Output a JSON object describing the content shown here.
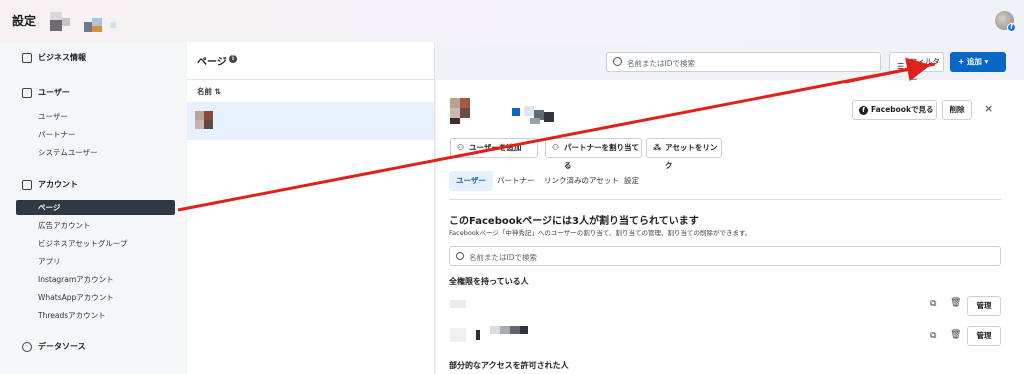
{
  "topbar": {
    "title": "設定"
  },
  "sidebar": {
    "business_info": "ビジネス情報",
    "users_section": "ユーザー",
    "users_items": [
      "ユーザー",
      "パートナー",
      "システムユーザー"
    ],
    "accounts_section": "アカウント",
    "accounts_items": [
      "ページ",
      "広告アカウント",
      "ビジネスアセットグループ",
      "アプリ",
      "Instagramアカウント",
      "WhatsAppアカウント",
      "Threadsアカウント"
    ],
    "datasource_section": "データソース"
  },
  "list": {
    "title": "ページ",
    "col_name": "名前 ⇅"
  },
  "toolbar": {
    "search_placeholder": "名前またはIDで検索",
    "filter_label": "フィルター",
    "add_label": "+ 追加 ▾"
  },
  "detail": {
    "view_fb": "Facebookで見る",
    "delete": "削除",
    "close": "×",
    "actions": [
      "ユーザーを追加",
      "パートナーを割り当てる",
      "アセットをリンク"
    ],
    "tabs": [
      "ユーザー",
      "パートナー",
      "リンク済みのアセット",
      "設定"
    ],
    "heading": "このFacebookページには3人が割り当てられています",
    "subtext": "Facebookページ「中神秀記」へのユーザーの割り当て、割り当ての管理、割り当ての削除ができます。",
    "search_placeholder": "名前またはIDで検索",
    "full_access_heading": "全権限を持っている人",
    "partial_access_heading": "部分的なアクセスを許可された人",
    "manage": "管理"
  },
  "colors": {
    "accent": "#0866c6",
    "active_nav": "#303845",
    "arrow": "#e0201b"
  }
}
